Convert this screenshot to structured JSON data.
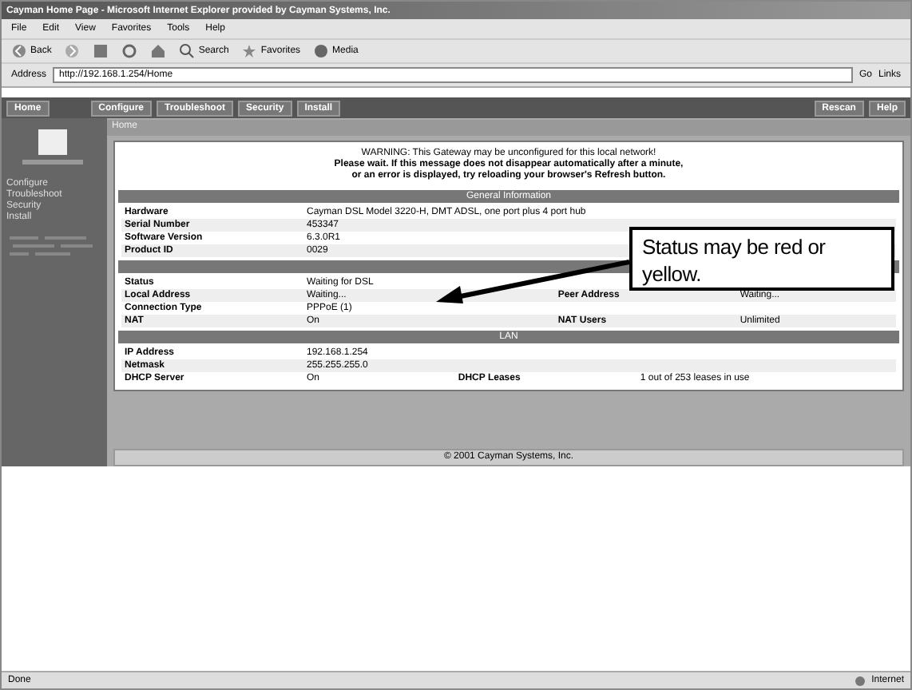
{
  "window": {
    "title": "Cayman Home Page - Microsoft Internet Explorer provided by Cayman Systems, Inc."
  },
  "menu": [
    "File",
    "Edit",
    "View",
    "Favorites",
    "Tools",
    "Help"
  ],
  "toolbar": [
    {
      "kind": "back",
      "label": "Back"
    },
    {
      "kind": "forward"
    },
    {
      "kind": "stop"
    },
    {
      "kind": "refresh"
    },
    {
      "kind": "home"
    },
    {
      "kind": "search",
      "label": "Search"
    },
    {
      "kind": "favorites",
      "label": "Favorites"
    },
    {
      "kind": "media",
      "label": "Media"
    }
  ],
  "address": {
    "label": "Address",
    "value": "http://192.168.1.254/Home",
    "go": "Go",
    "links": "Links"
  },
  "nav": {
    "home": "Home",
    "tabs": [
      "Configure",
      "Troubleshoot",
      "Security",
      "Install"
    ],
    "right": [
      "Rescan",
      "Help"
    ]
  },
  "sidebar": {
    "items": [
      "Configure",
      "Troubleshoot",
      "Security",
      "Install"
    ]
  },
  "breadcrumb": "Home",
  "notice": {
    "warning": "WARNING: This Gateway may be unconfigured for this local network!",
    "lines": [
      "Please wait. If this message does not disappear automatically after a minute,",
      "or an error is displayed, try reloading your browser's Refresh button."
    ]
  },
  "sections": [
    {
      "title": "General Information",
      "rows": [
        [
          "Hardware",
          "Cayman DSL Model 3220-H, DMT ADSL, one port plus 4 port hub"
        ],
        [
          "Serial Number",
          "453347"
        ],
        [
          "Software Version",
          "6.3.0R1"
        ],
        [
          "Product ID",
          "0029"
        ]
      ]
    },
    {
      "rows": [
        [
          "Status",
          "Waiting for DSL"
        ],
        [
          "Local Address",
          "Waiting...",
          "Peer Address",
          "Waiting..."
        ],
        [
          "Connection Type",
          "PPPoE (1)"
        ],
        [
          "NAT",
          "On",
          "NAT Users",
          "Unlimited"
        ]
      ]
    },
    {
      "title": "LAN",
      "rows": [
        [
          "IP Address",
          "192.168.1.254"
        ],
        [
          "Netmask",
          "255.255.255.0"
        ],
        [
          "DHCP Server",
          "On",
          "DHCP Leases",
          "1 out of 253 leases in use"
        ]
      ]
    }
  ],
  "footer": "© 2001 Cayman Systems, Inc.",
  "callout": "Status may be red or yellow.",
  "status_bar": {
    "left": "Done",
    "zone": "Internet"
  }
}
